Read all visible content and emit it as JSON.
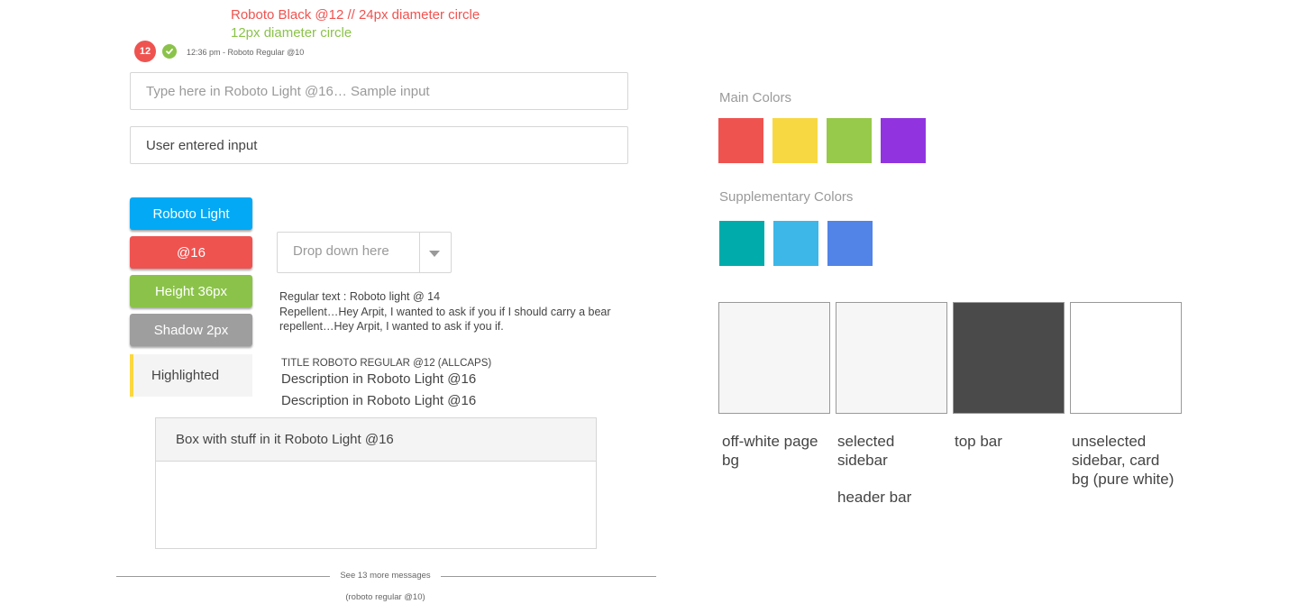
{
  "annotations": {
    "badge_note": "Roboto Black @12 // 24px diameter circle",
    "circle_note": "12px diameter circle",
    "timestamp_note": "12:36 pm - Roboto Regular @10"
  },
  "badge": {
    "count": "12",
    "icon": "check-circle-icon"
  },
  "inputs": {
    "sample_placeholder": "Type here in Roboto Light @16… Sample input",
    "user_value": "User entered input"
  },
  "buttons": {
    "blue_label": "Roboto Light",
    "red_label": "@16",
    "green_label": "Height 36px",
    "gray_label": "Shadow 2px"
  },
  "highlighted": {
    "label": "Highlighted"
  },
  "dropdown": {
    "placeholder": "Drop down here",
    "icon": "chevron-down-icon"
  },
  "regular_text": {
    "label": "Regular text : Roboto light @ 14",
    "body": "Repellent…Hey Arpit, I wanted to ask if you if I should carry a bear repellent…Hey Arpit, I wanted to ask if you if."
  },
  "title_block": {
    "title": "TITLE ROBOTO REGULAR @12 (ALLCAPS)",
    "desc1": "Description in Roboto Light @16",
    "desc2": "Description in Roboto Light @16"
  },
  "card": {
    "header": "Box with stuff in it Roboto Light @16"
  },
  "more_messages": {
    "link": "See 13 more messages",
    "note": "(roboto regular @10)"
  },
  "palette": {
    "main_heading": "Main Colors",
    "main_colors": [
      "#ef5350",
      "#f7d842",
      "#97c94a",
      "#9134e0"
    ],
    "supplementary_heading": "Supplementary Colors",
    "supplementary_colors": [
      "#00acab",
      "#3db7e8",
      "#5283e6"
    ],
    "backgrounds": [
      {
        "color": "#f6f6f6",
        "label": "off-white page bg"
      },
      {
        "color": "#f6f6f6",
        "label": "selected sidebar",
        "label_extra": "header bar"
      },
      {
        "color": "#4a4a4a",
        "label": "top bar"
      },
      {
        "color": "#ffffff",
        "label": "unselected sidebar, card bg (pure white)"
      }
    ]
  }
}
